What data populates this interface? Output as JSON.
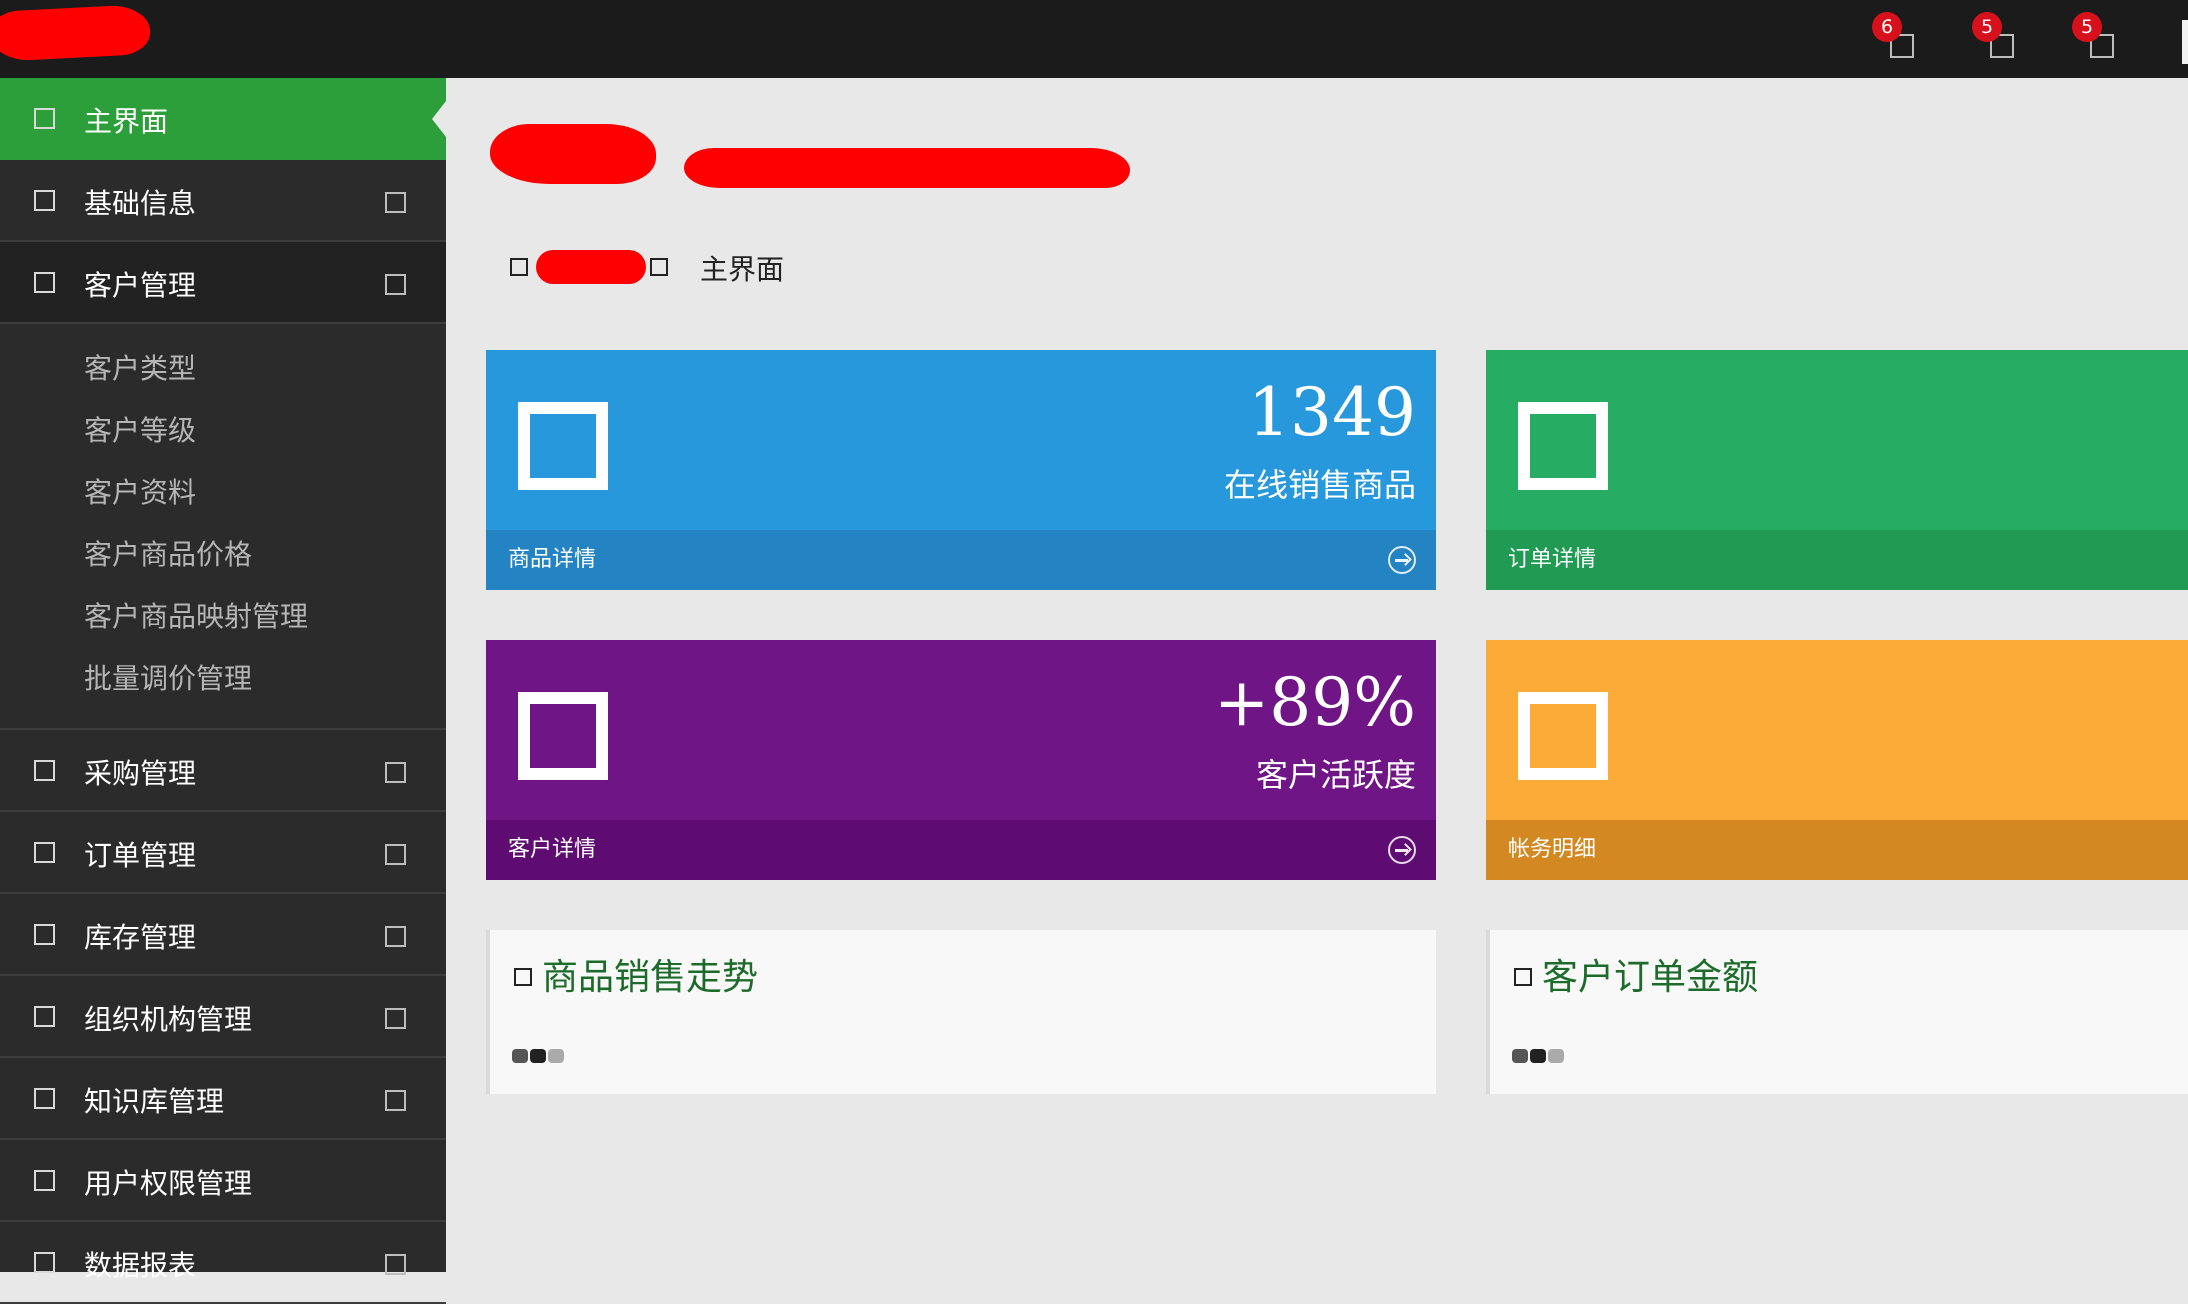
{
  "topbar": {
    "notifications": [
      {
        "count": "6"
      },
      {
        "count": "5"
      },
      {
        "count": "5"
      }
    ]
  },
  "sidebar": {
    "items": [
      {
        "label": "主界面"
      },
      {
        "label": "基础信息"
      },
      {
        "label": "客户管理",
        "children": [
          "客户类型",
          "客户等级",
          "客户资料",
          "客户商品价格",
          "客户商品映射管理",
          "批量调价管理"
        ]
      },
      {
        "label": "采购管理"
      },
      {
        "label": "订单管理"
      },
      {
        "label": "库存管理"
      },
      {
        "label": "组织机构管理"
      },
      {
        "label": "知识库管理"
      },
      {
        "label": "用户权限管理"
      },
      {
        "label": "数据报表"
      }
    ]
  },
  "breadcrumb": {
    "current": "主界面"
  },
  "tiles": {
    "products": {
      "value": "1349",
      "desc": "在线销售商品",
      "link": "商品详情",
      "color": "#2698db"
    },
    "orders": {
      "link": "订单详情",
      "color": "#27ad63"
    },
    "customers": {
      "value": "+89%",
      "desc": "客户活跃度",
      "link": "客户详情",
      "color": "#6f1585"
    },
    "accounts": {
      "link": "帐务明细",
      "color": "#fcab39"
    }
  },
  "panels": {
    "sales_trend": {
      "title": "商品销售走势"
    },
    "order_amount": {
      "title": "客户订单金额"
    }
  }
}
